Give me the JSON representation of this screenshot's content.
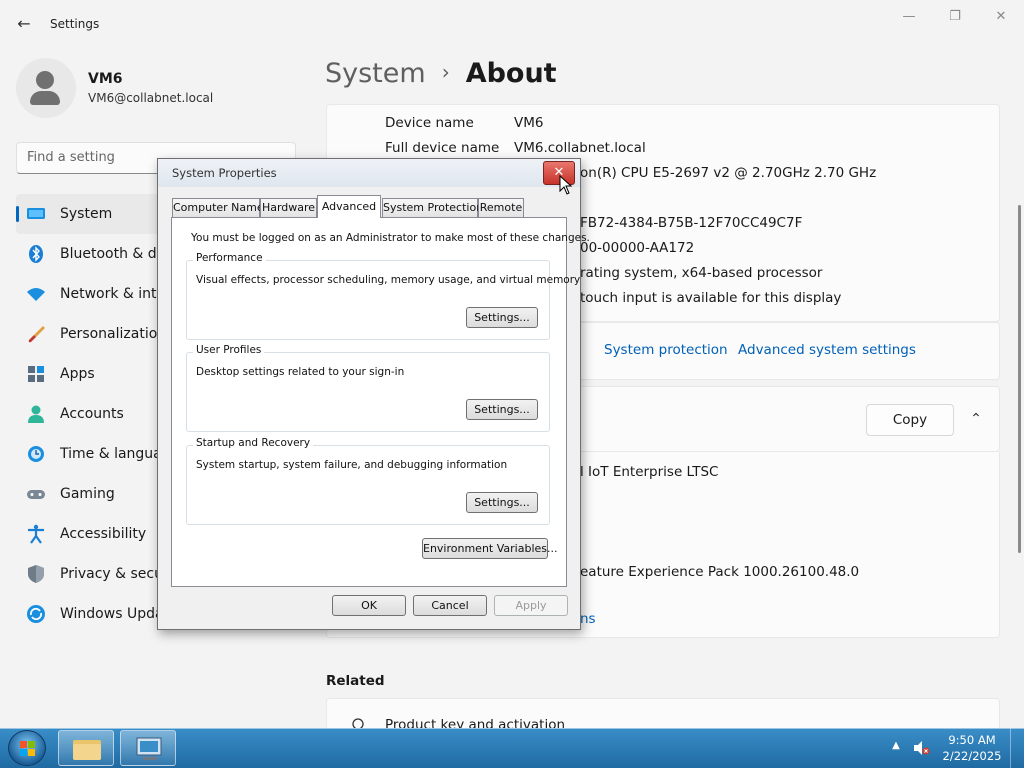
{
  "app": {
    "title": "Settings"
  },
  "profile": {
    "name": "VM6",
    "email": "VM6@collabnet.local"
  },
  "search": {
    "placeholder": "Find a setting"
  },
  "nav": {
    "items": [
      {
        "label": "System",
        "icon": "system-icon"
      },
      {
        "label": "Bluetooth & devices",
        "icon": "bluetooth-icon"
      },
      {
        "label": "Network & internet",
        "icon": "network-icon"
      },
      {
        "label": "Personalization",
        "icon": "brush-icon"
      },
      {
        "label": "Apps",
        "icon": "apps-icon"
      },
      {
        "label": "Accounts",
        "icon": "accounts-icon"
      },
      {
        "label": "Time & language",
        "icon": "clock-icon"
      },
      {
        "label": "Gaming",
        "icon": "gamepad-icon"
      },
      {
        "label": "Accessibility",
        "icon": "accessibility-icon"
      },
      {
        "label": "Privacy & security",
        "icon": "shield-icon"
      },
      {
        "label": "Windows Update",
        "icon": "update-icon"
      }
    ],
    "active_index": 0
  },
  "breadcrumb": {
    "parent": "System",
    "separator": "›",
    "current": "About"
  },
  "device_specs": [
    {
      "label": "Device name",
      "value": "VM6"
    },
    {
      "label": "Full device name",
      "value": "VM6.collabnet.local"
    },
    {
      "label": "",
      "value": "on(R) CPU E5-2697 v2 @ 2.70GHz   2.70 GHz"
    },
    {
      "label": "",
      "value": "FB72-4384-B75B-12F70CC49C7F"
    },
    {
      "label": "",
      "value": "00-00000-AA172"
    },
    {
      "label": "",
      "value": "rating system, x64-based processor"
    },
    {
      "label": "",
      "value": "touch input is available for this display"
    }
  ],
  "related_links": {
    "system_protection": "System protection",
    "advanced_system_settings": "Advanced system settings"
  },
  "windows_specs": {
    "copy_label": "Copy",
    "edition_fragment": "l IoT Enterprise LTSC",
    "experience_fragment": "eature Experience Pack 1000.26100.48.0",
    "link_fragment": "ns"
  },
  "related": {
    "heading": "Related",
    "first_item": "Product key and activation"
  },
  "dialog": {
    "title": "System Properties",
    "close_glyph": "✕",
    "tabs": [
      "Computer Name",
      "Hardware",
      "Advanced",
      "System Protection",
      "Remote"
    ],
    "active_tab": "Advanced",
    "notice": "You must be logged on as an Administrator to make most of these changes.",
    "groups": [
      {
        "label": "Performance",
        "description": "Visual effects, processor scheduling, memory usage, and virtual memory",
        "button": "Settings..."
      },
      {
        "label": "User Profiles",
        "description": "Desktop settings related to your sign-in",
        "button": "Settings..."
      },
      {
        "label": "Startup and Recovery",
        "description": "System startup, system failure, and debugging information",
        "button": "Settings..."
      }
    ],
    "env_button": "Environment Variables...",
    "ok": "OK",
    "cancel": "Cancel",
    "apply": "Apply"
  },
  "taskbar": {
    "time": "9:50 AM",
    "date": "2/22/2025"
  },
  "colors": {
    "accent": "#0067c0",
    "link": "#0060b8",
    "close_red": "#c7332a",
    "taskbar": "#1f6aa3"
  }
}
